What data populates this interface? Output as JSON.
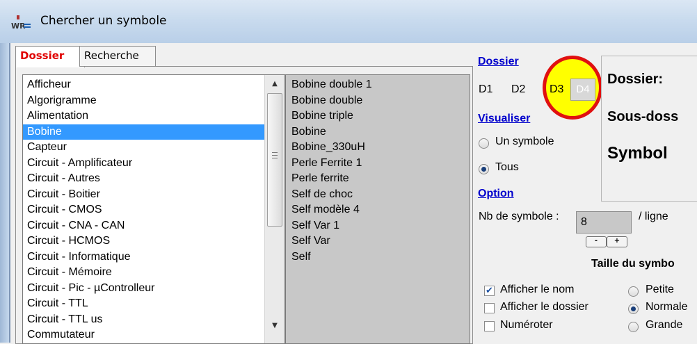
{
  "window": {
    "title": "Chercher un symbole"
  },
  "tabs": [
    {
      "label": "Dossier"
    },
    {
      "label": "Recherche"
    }
  ],
  "folders": {
    "selected_index": 3,
    "items": [
      "Afficheur",
      "Algorigramme",
      "Alimentation",
      "Bobine",
      "Capteur",
      "Circuit - Amplificateur",
      "Circuit - Autres",
      "Circuit - Boitier",
      "Circuit - CMOS",
      "Circuit - CNA - CAN",
      "Circuit - HCMOS",
      "Circuit - Informatique",
      "Circuit - Mémoire",
      "Circuit - Pic - µControlleur",
      "Circuit - TTL",
      "Circuit - TTL us",
      "Commutateur"
    ]
  },
  "symbols": {
    "items": [
      "Bobine double 1",
      "Bobine double",
      "Bobine triple",
      "Bobine",
      "Bobine_330uH",
      "Perle Ferrite 1",
      "Perle ferrite",
      "Self de choc",
      "Self modèle 4",
      "Self Var 1",
      "Self Var",
      "Self"
    ]
  },
  "right": {
    "dossier_title": "Dossier",
    "d_buttons": [
      "D1",
      "D2",
      "D3",
      "D4"
    ],
    "visualiser_title": "Visualiser",
    "radio_un_symbole": "Un symbole",
    "radio_tous": "Tous",
    "option_title": "Option",
    "nb_label": "Nb de symbole :",
    "nb_value": "8",
    "per_line": "/ ligne",
    "minus": "-",
    "plus": "+",
    "taille_title": "Taille du symbo",
    "chk_afficher_nom": "Afficher le nom",
    "chk_afficher_dossier": "Afficher le dossier",
    "chk_numeroter": "Numéroter",
    "size_petite": "Petite",
    "size_normale": "Normale",
    "size_grande": "Grande",
    "info_dossier": "Dossier:",
    "info_sous_dossier": "Sous-doss",
    "info_symbole": "Symbol"
  },
  "state": {
    "visualiser": "Tous",
    "afficher_nom": true,
    "afficher_dossier": false,
    "numeroter": false,
    "taille": "Normale",
    "highlighted_button": "D4"
  },
  "colors": {
    "selection": "#3399ff",
    "active_tab_text": "#e00000",
    "section_title": "#0000cc",
    "highlight_fill": "#ffff00",
    "highlight_ring": "#e01010"
  }
}
